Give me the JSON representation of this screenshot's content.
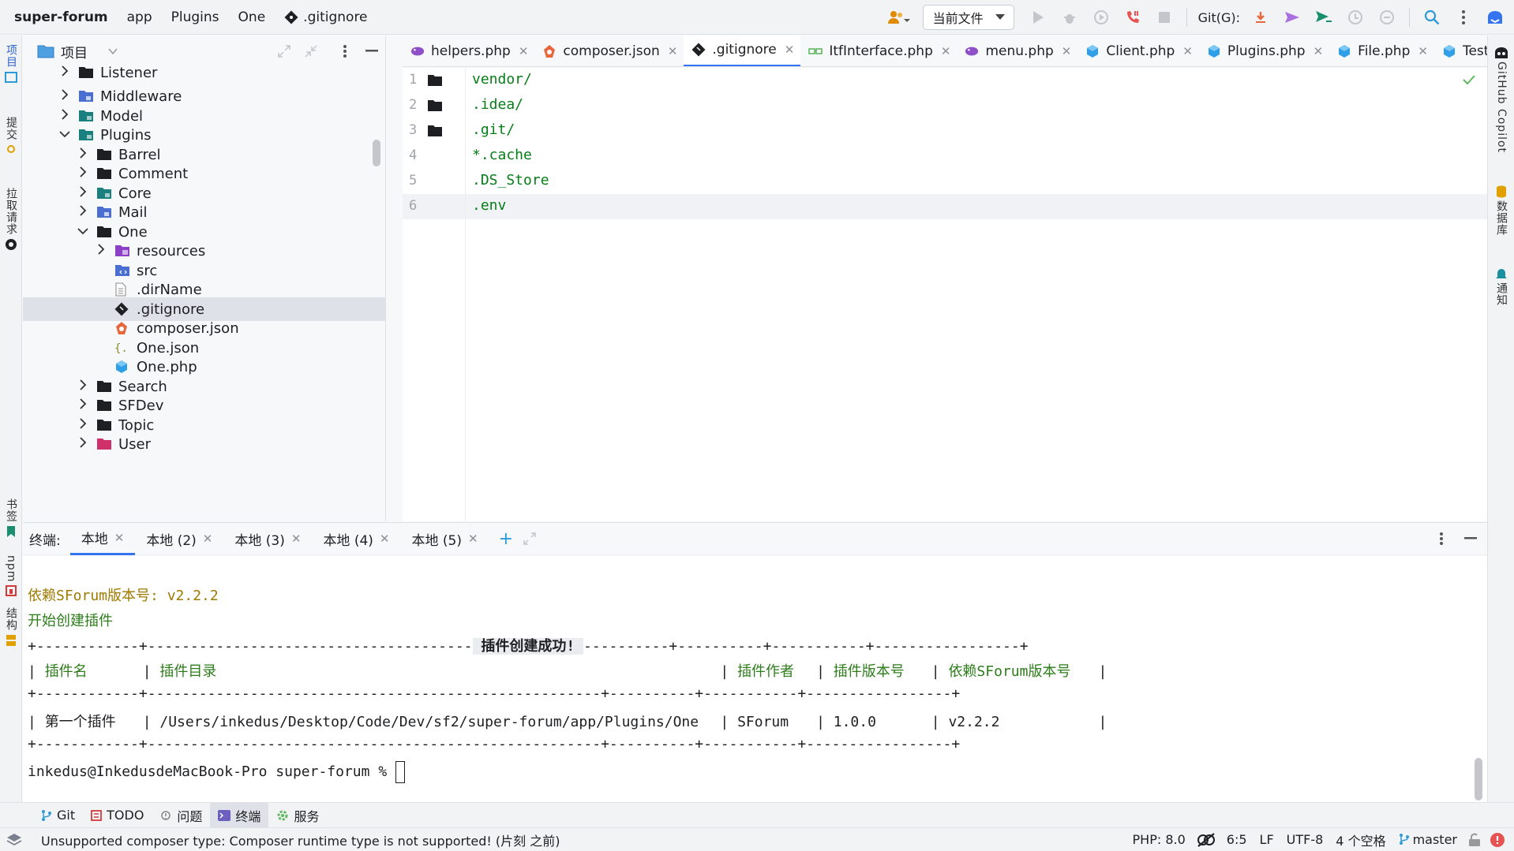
{
  "navbar": {
    "project": "super-forum",
    "crumbs": [
      "app",
      "Plugins",
      "One"
    ],
    "current_file": ".gitignore",
    "run_config": "当前文件",
    "git_label": "Git(G):"
  },
  "left_strip": {
    "project": "项目",
    "commit": "提交",
    "pull_requests": "拉取请求",
    "bookmarks": "书签",
    "npm": "npm",
    "structure": "结构"
  },
  "right_strip": {
    "copilot": "GitHub Copilot",
    "database": "数据库",
    "notifications": "通知"
  },
  "project_panel": {
    "title": "项目",
    "tree": [
      {
        "label": "Listener",
        "depth": 0,
        "chevron": "right",
        "icon": "folder"
      },
      {
        "label": "Middleware",
        "depth": 0,
        "chevron": "right",
        "icon": "folder-blue"
      },
      {
        "label": "Model",
        "depth": 0,
        "chevron": "right",
        "icon": "folder-teal"
      },
      {
        "label": "Plugins",
        "depth": 0,
        "chevron": "down",
        "icon": "folder-teal"
      },
      {
        "label": "Barrel",
        "depth": 1,
        "chevron": "right",
        "icon": "folder"
      },
      {
        "label": "Comment",
        "depth": 1,
        "chevron": "right",
        "icon": "folder"
      },
      {
        "label": "Core",
        "depth": 1,
        "chevron": "right",
        "icon": "folder-teal"
      },
      {
        "label": "Mail",
        "depth": 1,
        "chevron": "right",
        "icon": "folder-blue"
      },
      {
        "label": "One",
        "depth": 1,
        "chevron": "down",
        "icon": "folder"
      },
      {
        "label": "resources",
        "depth": 2,
        "chevron": "right",
        "icon": "folder-purple"
      },
      {
        "label": "src",
        "depth": 2,
        "chevron": "",
        "icon": "folder-src"
      },
      {
        "label": ".dirName",
        "depth": 2,
        "chevron": "",
        "icon": "file-text"
      },
      {
        "label": ".gitignore",
        "depth": 2,
        "chevron": "",
        "icon": "file-git",
        "selected": true
      },
      {
        "label": "composer.json",
        "depth": 2,
        "chevron": "",
        "icon": "file-composer"
      },
      {
        "label": "One.json",
        "depth": 2,
        "chevron": "",
        "icon": "file-json"
      },
      {
        "label": "One.php",
        "depth": 2,
        "chevron": "",
        "icon": "file-php"
      },
      {
        "label": "Search",
        "depth": 1,
        "chevron": "right",
        "icon": "folder"
      },
      {
        "label": "SFDev",
        "depth": 1,
        "chevron": "right",
        "icon": "folder"
      },
      {
        "label": "Topic",
        "depth": 1,
        "chevron": "right",
        "icon": "folder"
      },
      {
        "label": "User",
        "depth": 1,
        "chevron": "right",
        "icon": "folder-pink"
      }
    ]
  },
  "editor_tabs": [
    {
      "label": "helpers.php",
      "icon": "elephant"
    },
    {
      "label": "composer.json",
      "icon": "composer"
    },
    {
      "label": ".gitignore",
      "icon": "git",
      "active": true
    },
    {
      "label": "ItfInterface.php",
      "icon": "interface"
    },
    {
      "label": "menu.php",
      "icon": "elephant"
    },
    {
      "label": "Client.php",
      "icon": "php-class"
    },
    {
      "label": "Plugins.php",
      "icon": "php-class"
    },
    {
      "label": "File.php",
      "icon": "php-class"
    },
    {
      "label": "TestCc",
      "icon": "php-class",
      "noclose": true
    }
  ],
  "editor": {
    "lines": [
      {
        "num": "1",
        "text": "vendor/",
        "folder": true
      },
      {
        "num": "2",
        "text": ".idea/",
        "folder": true
      },
      {
        "num": "3",
        "text": ".git/",
        "folder": true
      },
      {
        "num": "4",
        "text": "*.cache"
      },
      {
        "num": "5",
        "text": ".DS_Store"
      },
      {
        "num": "6",
        "text": ".env",
        "current": true
      }
    ]
  },
  "terminal_tabs": {
    "label": "终端:",
    "tabs": [
      "本地",
      "本地 (2)",
      "本地 (3)",
      "本地 (4)",
      "本地 (5)"
    ]
  },
  "terminal": {
    "version_line": "依赖SForum版本号: v2.2.2",
    "start_line": "开始创建插件",
    "border_left": "+------------+--------------------------------------",
    "table_title": " 插件创建成功! ",
    "border_right": "----------+----------+-----------+-----------------+",
    "border_full": "+------------+-----------------------------------------------------+----------+-----------+-----------------+",
    "header": {
      "c1": "插件名",
      "c2": "插件目录",
      "c3": "插件作者",
      "c4": "插件版本号",
      "c5": "依赖SForum版本号"
    },
    "row": {
      "c1": "第一个插件",
      "c2": "/Users/inkedus/Desktop/Code/Dev/sf2/super-forum/app/Plugins/One",
      "c3": "SForum",
      "c4": "1.0.0",
      "c5": "v2.2.2"
    },
    "prompt": "inkedus@InkedusdeMacBook-Pro super-forum % "
  },
  "bottom_tools": [
    "Git",
    "TODO",
    "问题",
    "终端",
    "服务"
  ],
  "status": {
    "message": "Unsupported composer type: Composer runtime type is not supported! (片刻 之前)",
    "php": "PHP: 8.0",
    "position": "6:5",
    "line_sep": "LF",
    "encoding": "UTF-8",
    "indent": "4 个空格",
    "branch": "master"
  }
}
